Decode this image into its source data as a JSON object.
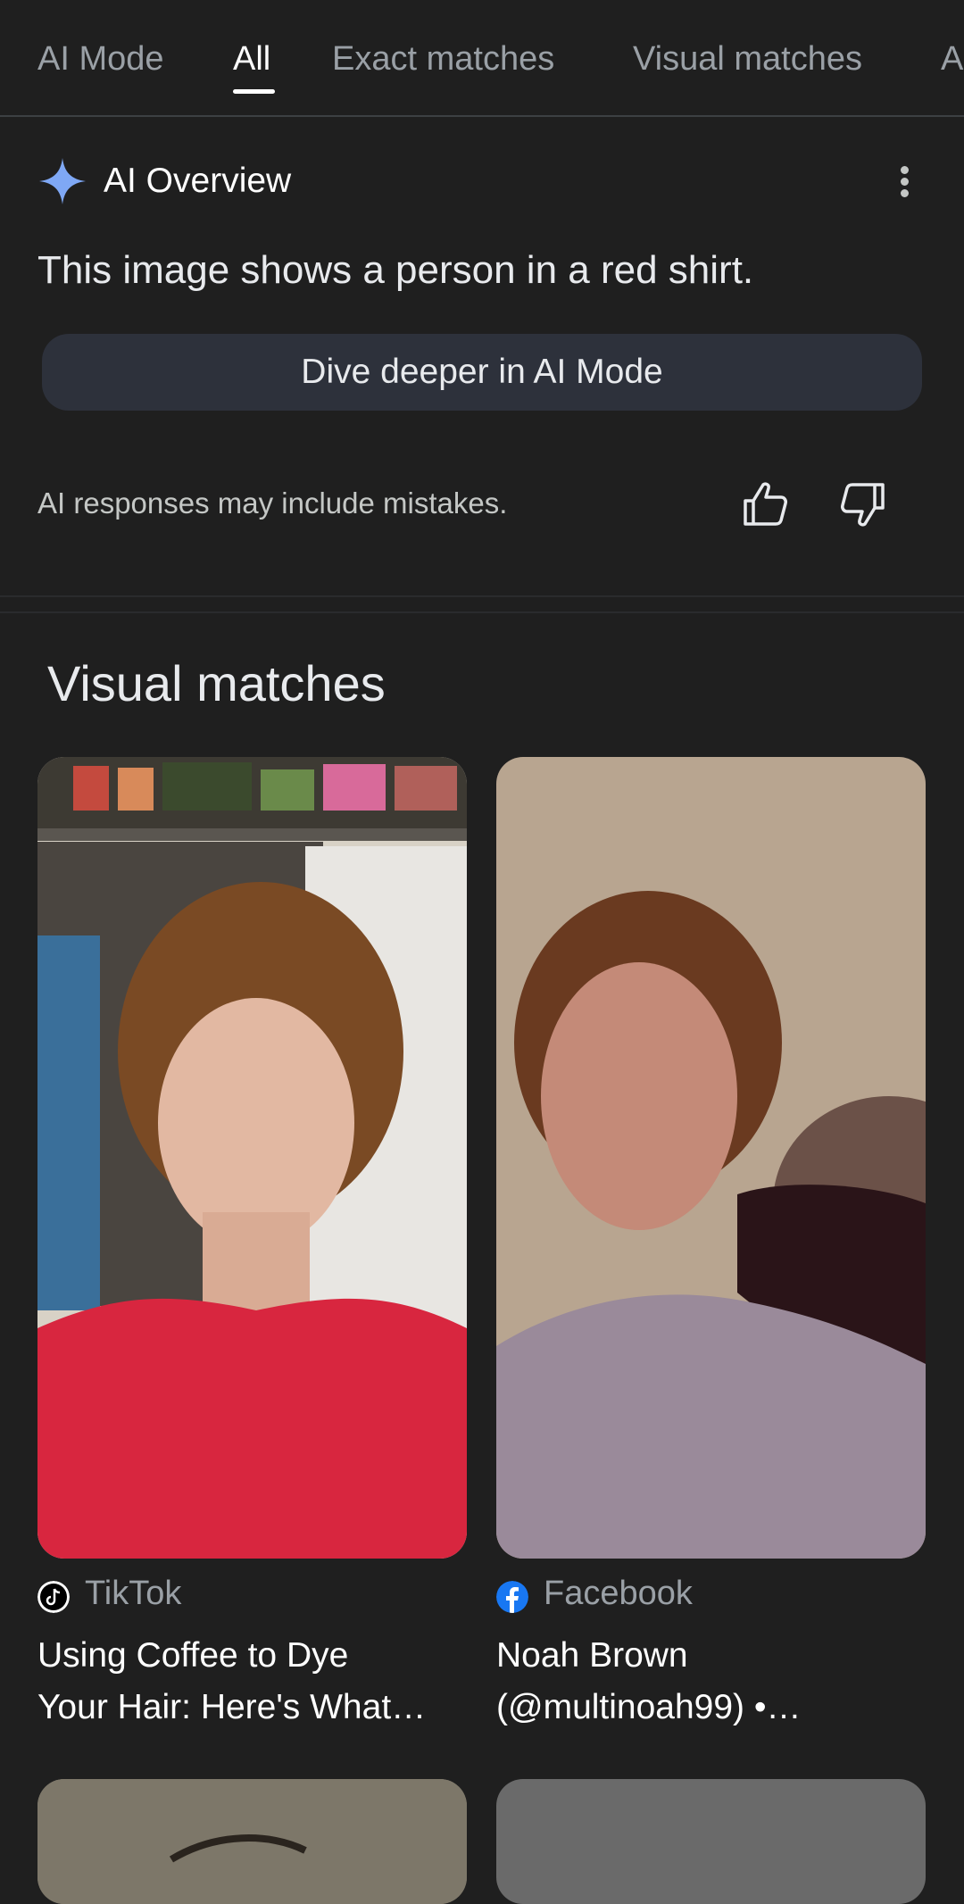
{
  "tabs": [
    "AI Mode",
    "All",
    "Exact matches",
    "Visual matches",
    "A"
  ],
  "active_tab": "All",
  "ai_overview": {
    "title": "AI Overview",
    "summary": "This image shows a person in a red shirt.",
    "dive_button": "Dive deeper in AI Mode",
    "disclaimer": "AI responses may include mistakes."
  },
  "visual_matches": {
    "heading": "Visual matches",
    "cards": [
      {
        "source": "TikTok",
        "title_line1": "Using Coffee to Dye",
        "title_line2": "Your Hair: Here's What…"
      },
      {
        "source": "Facebook",
        "title_line1": "Noah Brown",
        "title_line2": "(@multinoah99) •…"
      }
    ]
  },
  "colors": {
    "background": "#1f1f1f",
    "button": "#2d313b",
    "sparkle": "#7fa8f5",
    "facebook": "#1877f2"
  },
  "icons": [
    "sparkle-icon",
    "more-vert-icon",
    "thumbs-up-icon",
    "thumbs-down-icon",
    "tiktok-icon",
    "facebook-icon"
  ]
}
